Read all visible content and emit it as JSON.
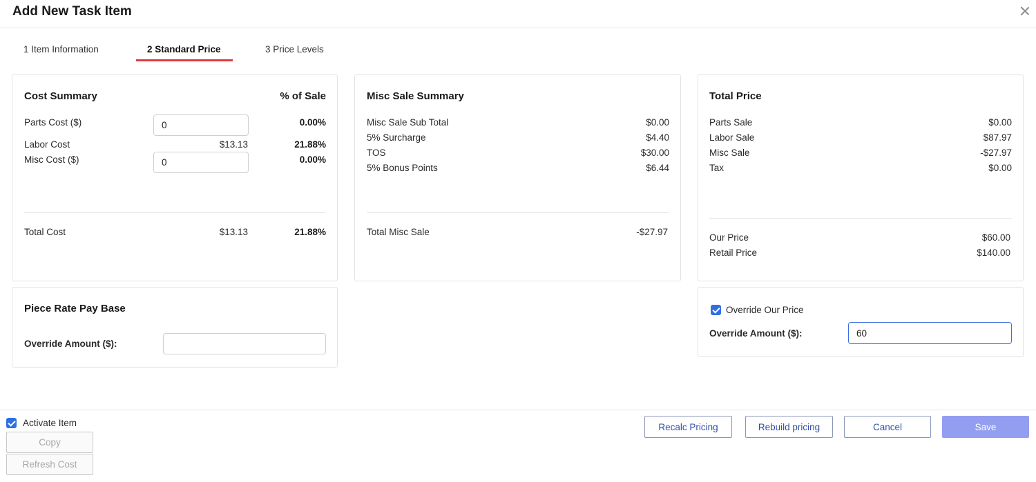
{
  "dialog": {
    "title": "Add New Task Item"
  },
  "tabs": [
    {
      "label": "1 Item Information"
    },
    {
      "label": "2 Standard Price"
    },
    {
      "label": "3 Price Levels"
    }
  ],
  "cost_summary": {
    "title": "Cost Summary",
    "pct_header": "% of Sale",
    "parts_cost_label": "Parts Cost ($)",
    "parts_cost_value": "0",
    "parts_cost_pct": "0.00%",
    "labor_cost_label": "Labor Cost",
    "labor_cost_value": "$13.13",
    "labor_cost_pct": "21.88%",
    "misc_cost_label": "Misc Cost ($)",
    "misc_cost_value": "0",
    "misc_cost_pct": "0.00%",
    "total_cost_label": "Total Cost",
    "total_cost_value": "$13.13",
    "total_cost_pct": "21.88%"
  },
  "misc_sale_summary": {
    "title": "Misc Sale Summary",
    "rows": [
      {
        "label": "Misc Sale Sub Total",
        "value": "$0.00"
      },
      {
        "label": "5% Surcharge",
        "value": "$4.40"
      },
      {
        "label": "TOS",
        "value": "$30.00"
      },
      {
        "label": "5% Bonus Points",
        "value": "$6.44"
      }
    ],
    "total_label": "Total Misc Sale",
    "total_value": "-$27.97"
  },
  "total_price": {
    "title": "Total Price",
    "rows": [
      {
        "label": "Parts Sale",
        "value": "$0.00"
      },
      {
        "label": "Labor Sale",
        "value": "$87.97"
      },
      {
        "label": "Misc Sale",
        "value": "-$27.97"
      },
      {
        "label": "Tax",
        "value": "$0.00"
      }
    ],
    "our_price_label": "Our Price",
    "our_price_value": "$60.00",
    "retail_price_label": "Retail Price",
    "retail_price_value": "$140.00"
  },
  "piece_rate": {
    "title": "Piece Rate Pay Base",
    "override_label": "Override Amount ($):",
    "override_value": ""
  },
  "override_price": {
    "checkbox_label": "Override Our Price",
    "checked": true,
    "override_label": "Override Amount ($):",
    "override_value": "60"
  },
  "footer": {
    "activate_label": "Activate Item",
    "activate_checked": true,
    "copy_label": "Copy",
    "refresh_label": "Refresh Cost",
    "recalc_label": "Recalc Pricing",
    "rebuild_label": "Rebuild pricing",
    "cancel_label": "Cancel",
    "save_label": "Save"
  },
  "colors": {
    "accent_blue": "#2f6fe4",
    "tab_underline": "#e0393e",
    "save_button": "#939ef0",
    "button_text": "#2e4fa8"
  }
}
